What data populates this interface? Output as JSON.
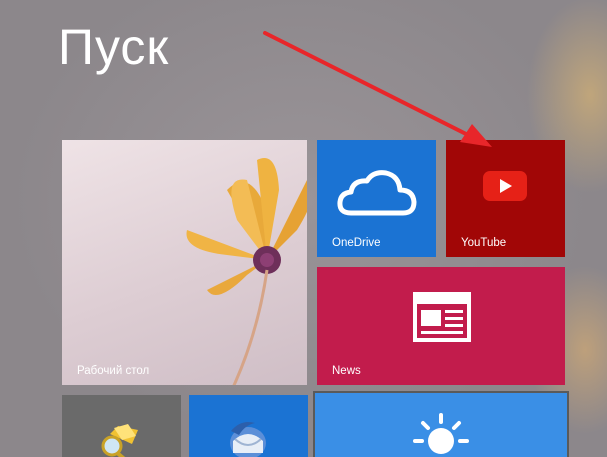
{
  "screen": {
    "title": "Пуск"
  },
  "tiles": {
    "desktop": {
      "label": "Рабочий стол",
      "color": "#e0d2d8"
    },
    "onedrive": {
      "label": "OneDrive",
      "color": "#1b73d3",
      "icon": "cloud-icon"
    },
    "youtube": {
      "label": "YouTube",
      "color": "#a10606",
      "icon": "play-icon"
    },
    "news": {
      "label": "News",
      "color": "#c21c4c",
      "icon": "newspaper-icon"
    },
    "small_a": {
      "color": "#6a6a6a",
      "icon": "folder-magnifier-icon"
    },
    "small_b": {
      "color": "#1b73d3",
      "icon": "thunderbird-icon"
    },
    "weather": {
      "color": "#3a8fe6",
      "icon": "sun-icon"
    }
  },
  "annotation": {
    "color": "#e8262a"
  }
}
